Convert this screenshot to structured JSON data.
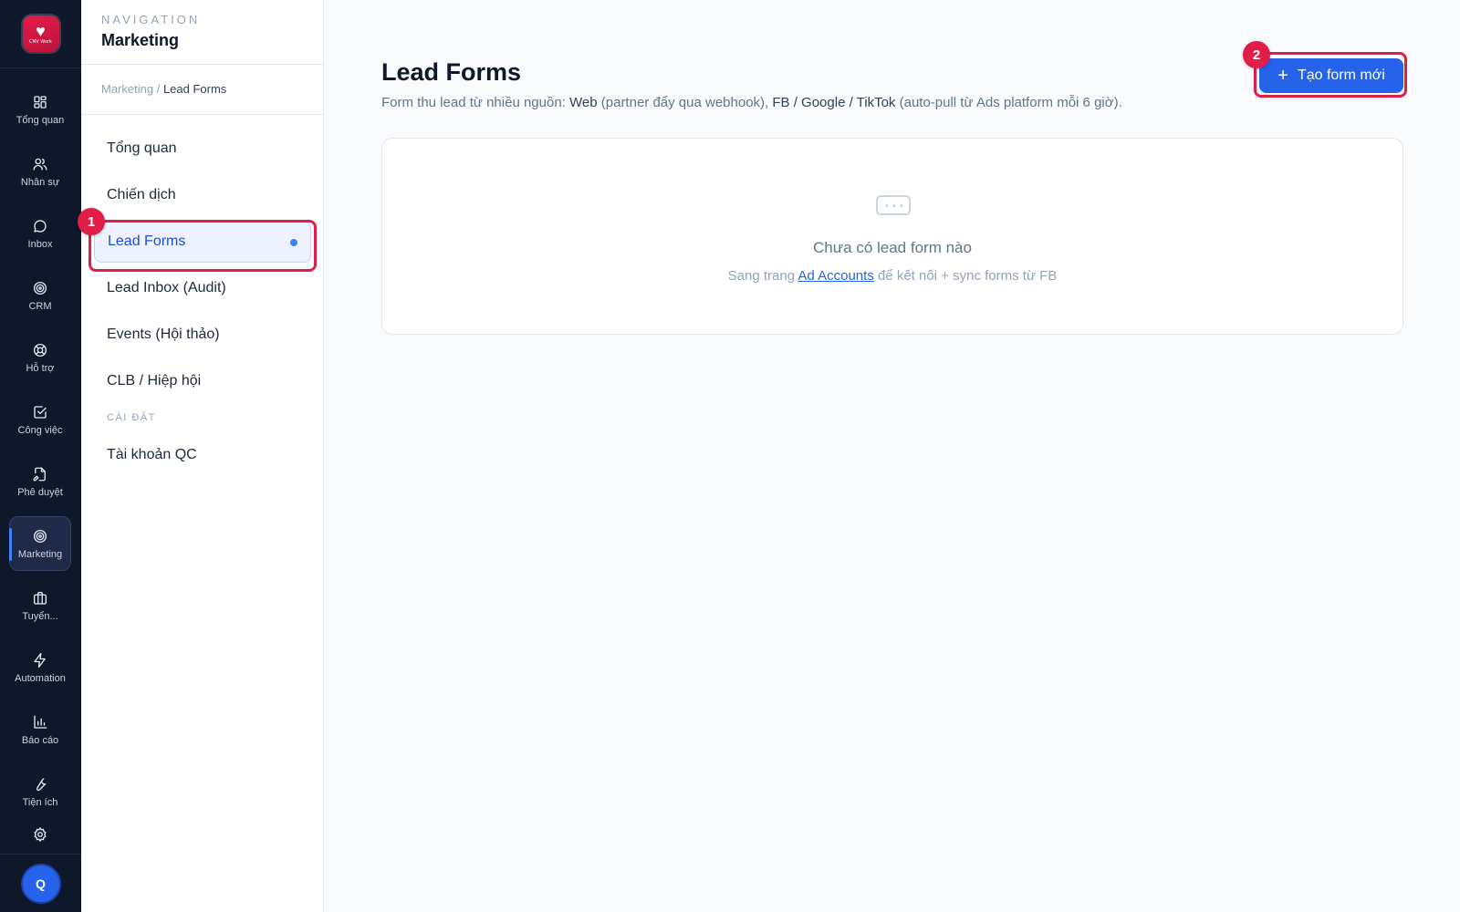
{
  "rail": {
    "logo_text": "CNV Work",
    "items": [
      {
        "label": "Tổng quan",
        "icon": "grid-icon"
      },
      {
        "label": "Nhân sự",
        "icon": "users-icon"
      },
      {
        "label": "Inbox",
        "icon": "chat-bubble-icon"
      },
      {
        "label": "CRM",
        "icon": "target-icon"
      },
      {
        "label": "Hỗ trợ",
        "icon": "lifebuoy-icon"
      },
      {
        "label": "Công việc",
        "icon": "checkbox-icon"
      },
      {
        "label": "Phê duyệt",
        "icon": "file-signature-icon"
      },
      {
        "label": "Marketing",
        "icon": "target-icon"
      },
      {
        "label": "Tuyển...",
        "icon": "briefcase-icon"
      },
      {
        "label": "Automation",
        "icon": "lightning-icon"
      },
      {
        "label": "Báo cáo",
        "icon": "bar-chart-icon"
      },
      {
        "label": "Tiện ích",
        "icon": "wrench-icon"
      }
    ],
    "active": "Marketing",
    "avatar_initial": "Q"
  },
  "nav": {
    "eyebrow": "NAVIGATION",
    "title": "Marketing",
    "breadcrumb": {
      "parent": "Marketing /",
      "current": "Lead Forms"
    },
    "items": [
      {
        "label": "Tổng quan"
      },
      {
        "label": "Chiến dịch"
      },
      {
        "label": "Lead Forms"
      },
      {
        "label": "Lead Inbox (Audit)"
      },
      {
        "label": "Events (Hội thảo)"
      },
      {
        "label": "CLB / Hiệp hội"
      }
    ],
    "active": "Lead Forms",
    "section_label": "CÀI ĐẶT",
    "settings_items": [
      {
        "label": "Tài khoản QC"
      }
    ]
  },
  "annotations": [
    {
      "label": "1"
    },
    {
      "label": "2"
    }
  ],
  "main": {
    "title": "Lead Forms",
    "subtitle": {
      "p1": "Form thu lead từ nhiều nguồn: ",
      "b1": "Web",
      "p2": " (partner đẩy qua webhook), ",
      "b2": "FB / Google / TikTok",
      "p3": " (auto-pull từ Ads platform mỗi 6 giờ)."
    },
    "create_button": {
      "label": "Tạo form mới",
      "icon": "plus-icon"
    },
    "empty_state": {
      "icon": "message-dots-icon",
      "title": "Chưa có lead form nào",
      "hint_prefix": "Sang trang ",
      "hint_link": "Ad Accounts",
      "hint_suffix": " để kết nối + sync forms từ FB"
    }
  },
  "colors": {
    "primary": "#2563eb",
    "annotation": "#e11d48",
    "rail_bg": "#0f172a"
  }
}
